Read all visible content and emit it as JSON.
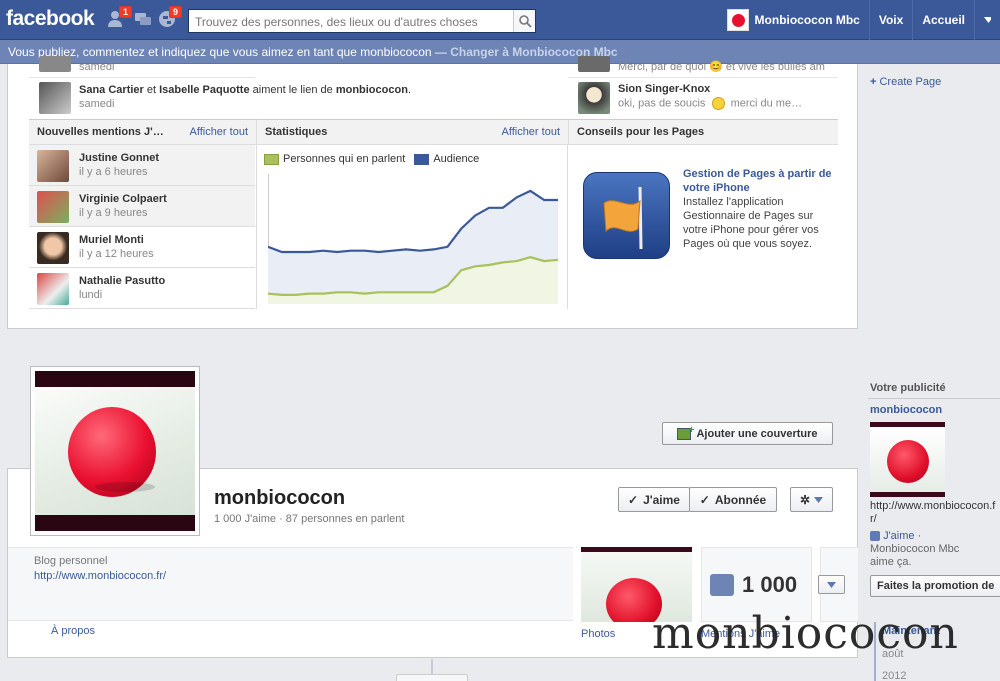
{
  "topbar": {
    "logo": "facebook",
    "friend_requests_badge": "1",
    "notifications_badge": "9",
    "search_placeholder": "Trouvez des personnes, des lieux ou d'autres choses",
    "profile_name": "Monbiococon Mbc",
    "nav": [
      "Voix",
      "Accueil"
    ]
  },
  "voicebar": {
    "text": "Vous publiez, commentez et indiquez que vous aimez en tant que monbiococon — ",
    "switch": "Changer à Monbiococon Mbc"
  },
  "activity": {
    "row1_left_partial": "samedi",
    "row2_left": {
      "name1": "Sana Cartier",
      "conj": " et ",
      "name2": "Isabelle Paquotte",
      "text": " aiment le lien de ",
      "page": "monbiococon",
      "end": ".",
      "time": "samedi"
    },
    "row1_right_partial": "Merci, par de quoi 😊 et vive les bulles am",
    "row2_right": {
      "name": "Sion Singer-Knox",
      "text": "oki, pas de soucis",
      "text2": "merci du me…"
    }
  },
  "mentions": {
    "title": "Nouvelles mentions J'…",
    "see_all": "Afficher tout",
    "items": [
      {
        "name": "Justine Gonnet",
        "time": "il y a 6 heures"
      },
      {
        "name": "Virginie Colpaert",
        "time": "il y a 9 heures"
      },
      {
        "name": "Muriel Monti",
        "time": "il y a 12 heures"
      },
      {
        "name": "Nathalie Pasutto",
        "time": "lundi"
      }
    ]
  },
  "stats": {
    "title": "Statistiques",
    "see_all": "Afficher tout",
    "legend": [
      "Personnes qui en parlent",
      "Audience"
    ]
  },
  "chart_data": {
    "type": "line",
    "series": [
      {
        "name": "Personnes qui en parlent",
        "color": "#a9c15a",
        "values": [
          0.08,
          0.07,
          0.07,
          0.08,
          0.08,
          0.09,
          0.09,
          0.08,
          0.09,
          0.09,
          0.09,
          0.09,
          0.09,
          0.14,
          0.26,
          0.29,
          0.3,
          0.32,
          0.33,
          0.36,
          0.33,
          0.34
        ]
      },
      {
        "name": "Audience",
        "color": "#3b5998",
        "values": [
          0.44,
          0.4,
          0.4,
          0.4,
          0.41,
          0.4,
          0.41,
          0.41,
          0.4,
          0.41,
          0.42,
          0.41,
          0.42,
          0.44,
          0.58,
          0.68,
          0.74,
          0.74,
          0.82,
          0.87,
          0.8,
          0.8
        ]
      }
    ]
  },
  "tips": {
    "title": "Conseils pour les Pages",
    "link": "Gestion de Pages à partir de votre iPhone",
    "body": "Installez l'application Gestionnaire de Pages sur votre iPhone pour gérer vos Pages où que vous soyez."
  },
  "rightcol": {
    "create_page": "Create Page",
    "ad_header": "Votre publicité",
    "ad_name": "monbiococon",
    "ad_url": "http://www.monbiococon.fr/",
    "ad_like": "J'aime",
    "ad_liker": "Monbiococon Mbc aime ça.",
    "promo_btn": "Faites la promotion de",
    "timeline": [
      "Maintenant",
      "août",
      "2012"
    ]
  },
  "profile": {
    "add_cover": "Ajouter une couverture",
    "name": "monbiococon",
    "stats": "1 000 J'aime · 87 personnes en parlent",
    "like_btn": "J'aime",
    "follow_btn": "Abonnée",
    "category": "Blog personnel",
    "website": "http://www.monbiococon.fr/",
    "about": "À propos",
    "photos_label": "Photos",
    "likes_count": "1 000",
    "likes_label": "Mentions J'aime"
  },
  "watermark": "monbiococon",
  "colors": {
    "brand": "#3b5998",
    "voicebar": "#6d84b4",
    "badge": "#f03d25"
  }
}
